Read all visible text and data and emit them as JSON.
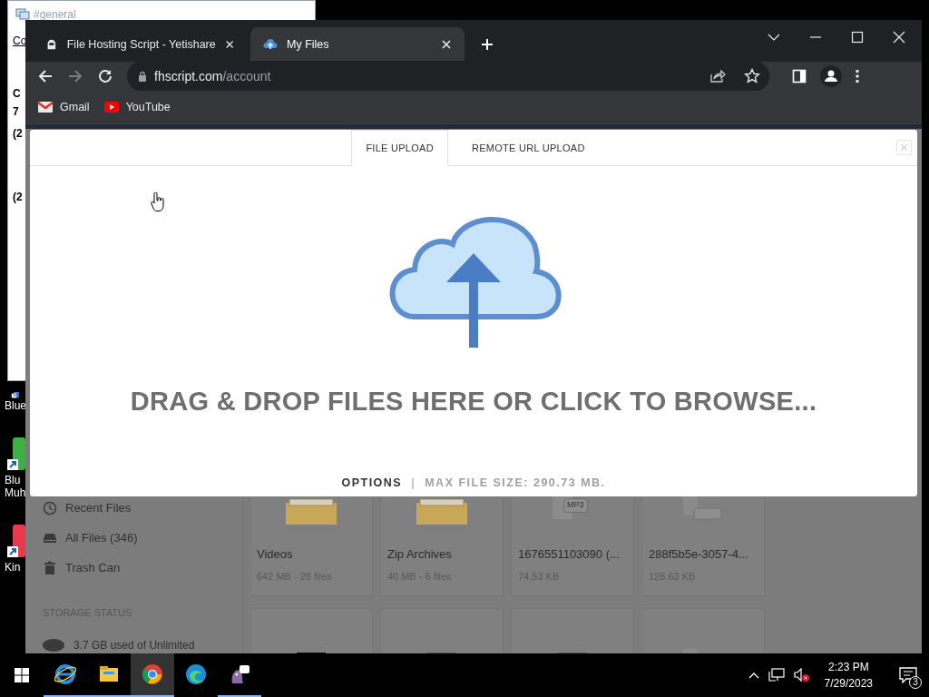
{
  "behind_window": {
    "title": "#general",
    "menu": "Co",
    "lines": [
      "C",
      "7",
      "(2",
      "(2"
    ]
  },
  "desktop_icons": [
    {
      "kind": "bluestacks",
      "lines": [
        "Blue"
      ]
    },
    {
      "kind": "multi",
      "lines": [
        "Blu",
        "Muh"
      ]
    },
    {
      "kind": "kinza",
      "lines": [
        "Kin"
      ]
    }
  ],
  "browser": {
    "tabs": [
      {
        "title": "File Hosting Script - Yetishare",
        "kind": "yeti",
        "selected": false
      },
      {
        "title": "My Files",
        "kind": "cloud",
        "selected": true
      }
    ],
    "url": {
      "host": "fhscript.com",
      "path": "/account"
    },
    "bookmarks": [
      {
        "label": "Gmail",
        "kind": "gmail"
      },
      {
        "label": "YouTube",
        "kind": "youtube"
      }
    ]
  },
  "page": {
    "sidebar": [
      {
        "label": "Recent Files",
        "kind": "clock"
      },
      {
        "label": "All Files (346)",
        "kind": "drive"
      },
      {
        "label": "Trash Can",
        "kind": "trash"
      }
    ],
    "storage_heading": "STORAGE STATUS",
    "storage_text": "3.7 GB used of Unlimited",
    "files": [
      {
        "name": "Videos",
        "meta": "642 MB - 28 files",
        "kind": "folder"
      },
      {
        "name": "Zip Archives",
        "meta": "40 MB - 6 files",
        "kind": "folder"
      },
      {
        "name": "1676551103090 (...",
        "meta": "74.53 KB",
        "kind": "audio",
        "badge": "MP3"
      },
      {
        "name": "288f5b5e-3057-4...",
        "meta": "128.63 KB",
        "kind": "generic"
      },
      {
        "kind": "video"
      },
      {
        "kind": "image"
      },
      {
        "kind": "image"
      },
      {
        "kind": "generic"
      }
    ]
  },
  "modal": {
    "tabs": [
      {
        "label": "FILE UPLOAD",
        "selected": true
      },
      {
        "label": "REMOTE URL UPLOAD",
        "selected": false
      }
    ],
    "message": "DRAG & DROP FILES HERE OR CLICK TO BROWSE...",
    "options": "OPTIONS",
    "separator": "|",
    "max_size": "MAX FILE SIZE: 290.73 MB."
  },
  "taskbar": {
    "apps": [
      {
        "kind": "ie",
        "running": true,
        "active": false
      },
      {
        "kind": "explorer",
        "running": true,
        "active": false
      },
      {
        "kind": "chrome",
        "running": true,
        "active": true
      },
      {
        "kind": "edge",
        "running": false,
        "active": false
      },
      {
        "kind": "pidgin",
        "running": true,
        "active": false
      }
    ],
    "time": "2:23 PM",
    "date": "7/29/2023",
    "notifications": "3"
  }
}
